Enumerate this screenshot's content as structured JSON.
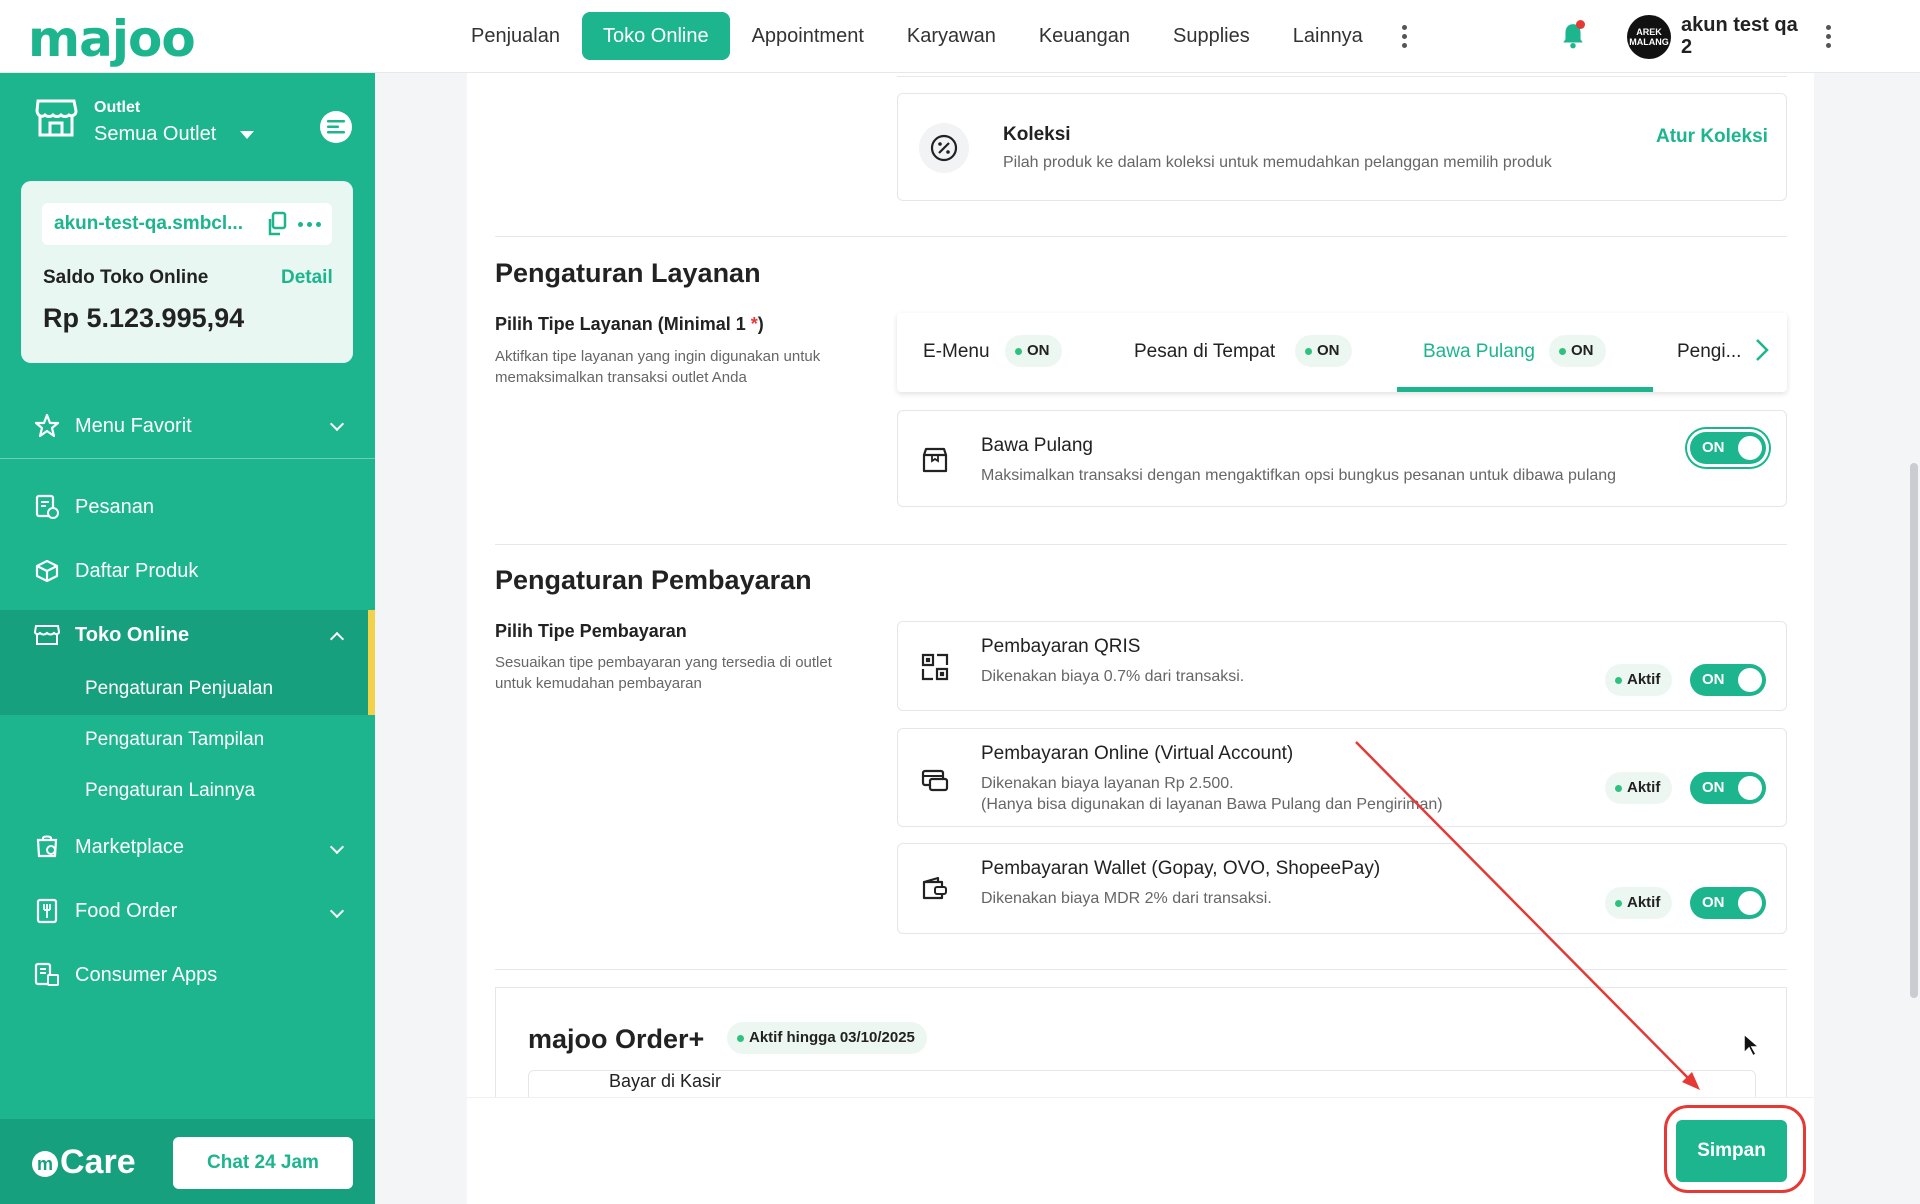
{
  "brand": {
    "logo": "majoo",
    "accent": "#1cb58e"
  },
  "topnav": {
    "items": [
      "Penjualan",
      "Toko Online",
      "Appointment",
      "Karyawan",
      "Keuangan",
      "Supplies",
      "Lainnya"
    ],
    "active": "Toko Online"
  },
  "user": {
    "avatar_text": "AREK MALANG",
    "name": "akun test qa 2"
  },
  "sidebar": {
    "outlet_label": "Outlet",
    "outlet_value": "Semua Outlet",
    "store_url": "akun-test-qa.smbcl...",
    "balance_label": "Saldo Toko Online",
    "balance_detail": "Detail",
    "balance_value": "Rp 5.123.995,94",
    "menu_favorit": "Menu Favorit",
    "items": {
      "pesanan": "Pesanan",
      "daftar_produk": "Daftar Produk",
      "toko_online": "Toko Online",
      "pengaturan_penjualan": "Pengaturan Penjualan",
      "pengaturan_tampilan": "Pengaturan Tampilan",
      "pengaturan_lainnya": "Pengaturan Lainnya",
      "marketplace": "Marketplace",
      "food_order": "Food Order",
      "consumer_apps": "Consumer Apps"
    },
    "care_label": "Care",
    "chat_button": "Chat 24 Jam"
  },
  "koleksi": {
    "title": "Koleksi",
    "desc": "Pilah produk ke dalam koleksi untuk memudahkan pelanggan memilih produk",
    "action": "Atur Koleksi"
  },
  "layanan": {
    "section_title": "Pengaturan Layanan",
    "field_label": "Pilih Tipe Layanan (Minimal 1 ",
    "required_mark": "*",
    "field_label_end": ")",
    "field_desc": "Aktifkan tipe layanan yang ingin digunakan untuk memaksimalkan transaksi outlet Anda",
    "tabs": [
      {
        "label": "E-Menu",
        "badge": "ON"
      },
      {
        "label": "Pesan di Tempat",
        "badge": "ON"
      },
      {
        "label": "Bawa Pulang",
        "badge": "ON"
      },
      {
        "label": "Pengi...",
        "badge": ""
      }
    ],
    "active_tab": "Bawa Pulang",
    "detail_title": "Bawa Pulang",
    "detail_desc": "Maksimalkan transaksi dengan mengaktifkan opsi bungkus pesanan untuk dibawa pulang",
    "detail_toggle": "ON"
  },
  "pembayaran": {
    "section_title": "Pengaturan Pembayaran",
    "field_label": "Pilih Tipe Pembayaran",
    "field_desc": "Sesuaikan tipe pembayaran yang tersedia di outlet untuk kemudahan pembayaran",
    "items": [
      {
        "title": "Pembayaran QRIS",
        "desc1": "Dikenakan biaya 0.7% dari transaksi.",
        "desc2": "",
        "badge": "Aktif",
        "toggle": "ON"
      },
      {
        "title": "Pembayaran Online (Virtual Account)",
        "desc1": "Dikenakan biaya layanan Rp 2.500.",
        "desc2": "(Hanya bisa digunakan di layanan Bawa Pulang dan Pengiriman)",
        "badge": "Aktif",
        "toggle": "ON"
      },
      {
        "title": "Pembayaran Wallet (Gopay, OVO, ShopeePay)",
        "desc1": "Dikenakan biaya MDR 2% dari transaksi.",
        "desc2": "",
        "badge": "Aktif",
        "toggle": "ON"
      }
    ]
  },
  "order_plus": {
    "title": "majoo Order+",
    "badge": "Aktif hingga 03/10/2025",
    "first_row": "Bayar di Kasir"
  },
  "footer": {
    "save_button": "Simpan"
  },
  "annotation_color": "#e53935"
}
